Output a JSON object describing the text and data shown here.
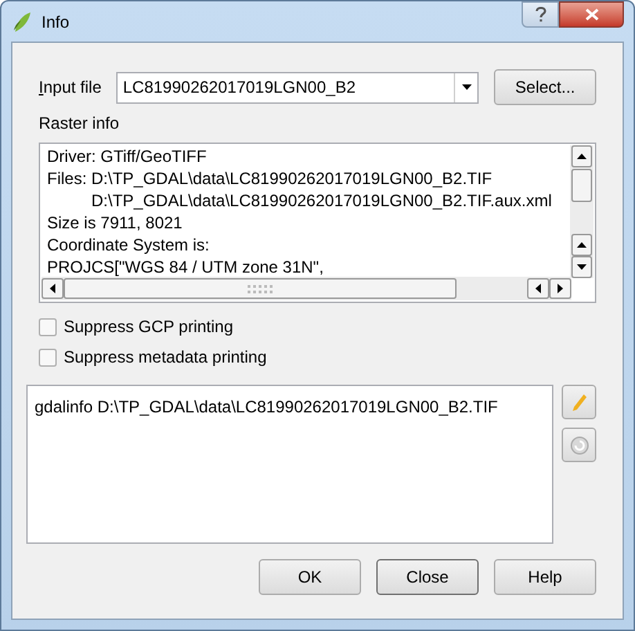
{
  "window": {
    "title": "Info"
  },
  "input_file": {
    "label": "Input file",
    "value": "LC81990262017019LGN00_B2"
  },
  "select_button": "Select...",
  "raster_info": {
    "label": "Raster info",
    "lines": [
      {
        "kind": "line",
        "text": "Driver: GTiff/GeoTIFF"
      },
      {
        "kind": "line",
        "text": "Files: D:\\TP_GDAL\\data\\LC81990262017019LGN00_B2.TIF"
      },
      {
        "kind": "continuation",
        "text": "D:\\TP_GDAL\\data\\LC81990262017019LGN00_B2.TIF.aux.xml"
      },
      {
        "kind": "line",
        "text": "Size is 7911, 8021"
      },
      {
        "kind": "line",
        "text": "Coordinate System is:"
      },
      {
        "kind": "line",
        "text": "PROJCS[\"WGS 84 / UTM zone 31N\","
      }
    ]
  },
  "options": [
    {
      "label": "Suppress GCP printing",
      "checked": false
    },
    {
      "label": "Suppress metadata printing",
      "checked": false
    }
  ],
  "command": {
    "value": "gdalinfo D:\\TP_GDAL\\data\\LC81990262017019LGN00_B2.TIF"
  },
  "buttons": [
    "OK",
    "Close",
    "Help"
  ]
}
